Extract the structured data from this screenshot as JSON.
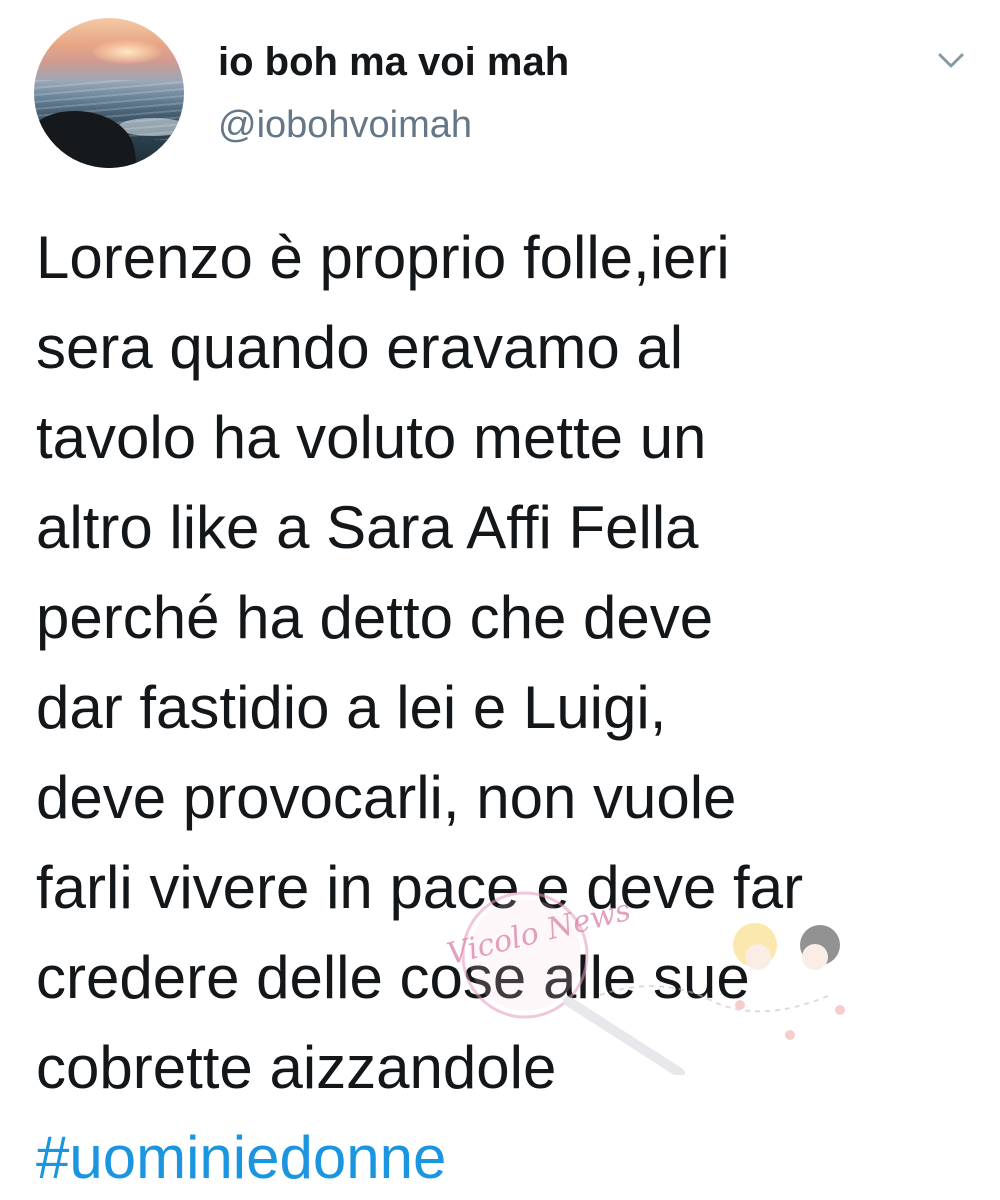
{
  "tweet": {
    "author": {
      "display_name": "io boh ma voi mah",
      "handle": "@iobohvoimah",
      "avatar_icon": "sunset-sea-avatar"
    },
    "menu_icon": "chevron-down-icon",
    "text_lines": [
      "Lorenzo è proprio folle,ieri",
      "sera quando eravamo al",
      "tavolo ha voluto mette un",
      "altro like a Sara Affi Fella",
      "perché ha detto che deve",
      "dar fastidio a lei e Luigi,",
      "deve provocarli, non vuole",
      "farli vivere in pace e deve far",
      "credere delle cose alle sue",
      "cobrette aizzandole"
    ],
    "hashtag": "#uominiedonne"
  },
  "watermark": {
    "text": "Vicolo News"
  },
  "colors": {
    "text": "#14171a",
    "secondary": "#657786",
    "link": "#1b95e0",
    "watermark": "#d87ba0"
  }
}
